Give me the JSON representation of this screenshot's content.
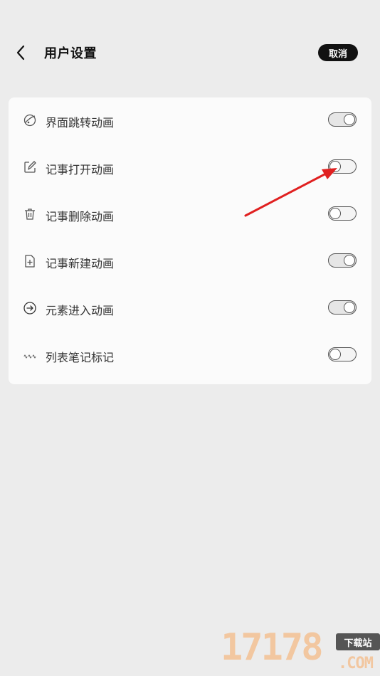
{
  "header": {
    "title": "用户设置",
    "cancel_label": "取消"
  },
  "settings": [
    {
      "icon": "palette-icon",
      "label": "界面跳转动画",
      "enabled": true
    },
    {
      "icon": "edit-icon",
      "label": "记事打开动画",
      "enabled": false
    },
    {
      "icon": "trash-icon",
      "label": "记事删除动画",
      "enabled": false
    },
    {
      "icon": "new-note-icon",
      "label": "记事新建动画",
      "enabled": true
    },
    {
      "icon": "enter-icon",
      "label": "元素进入动画",
      "enabled": true
    },
    {
      "icon": "list-icon",
      "label": "列表笔记标记",
      "enabled": false
    }
  ],
  "watermark": {
    "number": "17178",
    "tag": "下载站",
    "domain": ".COM"
  }
}
